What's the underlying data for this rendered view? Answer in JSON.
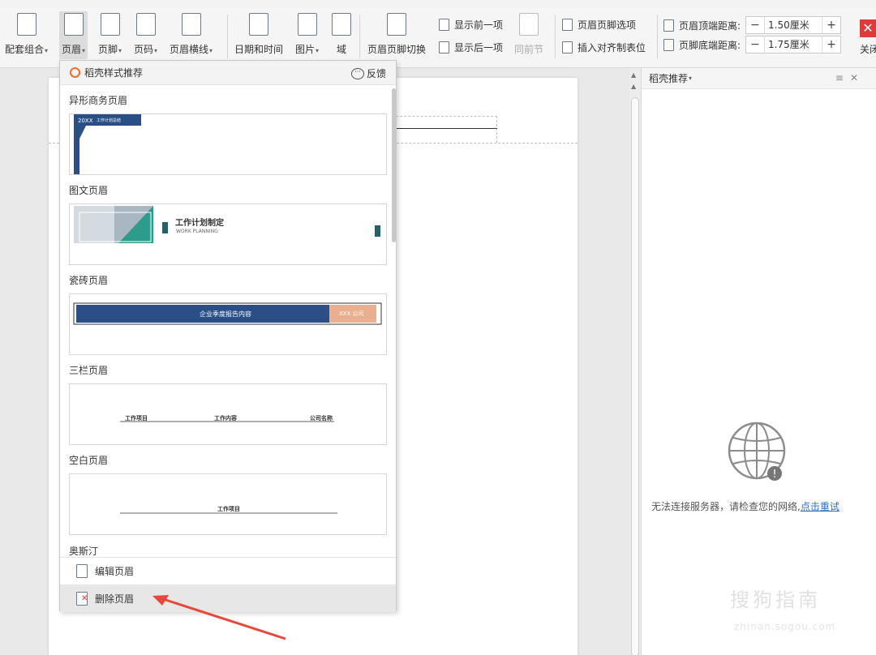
{
  "ribbon": {
    "buttons": [
      {
        "label": "配套组合",
        "icon": "template-combo-icon"
      },
      {
        "label": "页眉",
        "icon": "header-icon"
      },
      {
        "label": "页脚",
        "icon": "footer-icon"
      },
      {
        "label": "页码",
        "icon": "page-number-icon"
      },
      {
        "label": "页眉横线",
        "icon": "header-line-icon"
      },
      {
        "label": "日期和时间",
        "icon": "calendar-icon"
      },
      {
        "label": "图片",
        "icon": "picture-icon"
      },
      {
        "label": "域",
        "icon": "field-icon"
      },
      {
        "label": "页眉页脚切换",
        "icon": "switch-header-footer-icon"
      }
    ],
    "show_prev": "显示前一项",
    "show_next": "显示后一项",
    "same_as_prev": "同前节",
    "hf_options": "页眉页脚选项",
    "insert_align_tab": "插入对齐制表位",
    "header_top_label": "页眉顶端距离:",
    "header_top_value": "1.50厘米",
    "footer_bottom_label": "页脚底端距离:",
    "footer_bottom_value": "1.75厘米",
    "close_label": "关闭",
    "minus": "−",
    "plus": "+"
  },
  "dropdown": {
    "header": "稻壳样式推荐",
    "feedback": "反馈",
    "sections": [
      {
        "title": "异形商务页眉",
        "card_texts": [
          "20XX",
          "工作计划总结"
        ]
      },
      {
        "title": "图文页眉",
        "card_texts": [
          "工作计划制定",
          "WORK PLANNING"
        ]
      },
      {
        "title": "瓷砖页眉",
        "card_texts": [
          "企业季度报告内容",
          "XXX 公司"
        ]
      },
      {
        "title": "三栏页眉",
        "card_texts": [
          "工作项目",
          "工作内容",
          "公司名称"
        ]
      },
      {
        "title": "空白页眉",
        "card_texts": [
          "工作项目"
        ]
      },
      {
        "title": "奥斯汀",
        "card_texts": []
      }
    ],
    "edit_header": "编辑页眉",
    "delete_header": "删除页眉"
  },
  "side_panel": {
    "title": "稻壳推荐",
    "offline_message": "无法连接服务器，请检查您的网络,",
    "retry_link": "点击重试"
  },
  "watermark": {
    "text": "搜狗指南",
    "sub": "zhinan.sogou.com"
  },
  "colors": {
    "accent_blue": "#2a4e86",
    "teal": "#2e9c8c",
    "peach": "#e8b08e",
    "close_red": "#e03b3b"
  }
}
